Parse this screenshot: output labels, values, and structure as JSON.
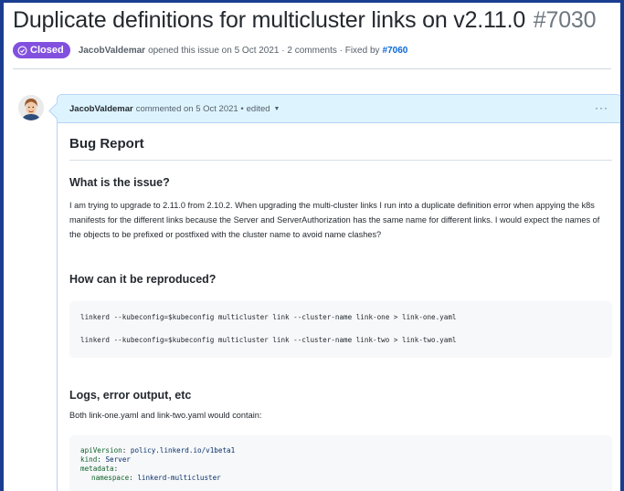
{
  "issue": {
    "title": "Duplicate definitions for multicluster links on v2.11.0",
    "number": "#7030",
    "state": "Closed",
    "author": "JacobValdemar",
    "opened_text": "opened this issue on 5 Oct 2021 · 2 comments · Fixed by",
    "fixed_by": "#7060"
  },
  "comment": {
    "author": "JacobValdemar",
    "meta": "commented on 5 Oct 2021 •",
    "edited": "edited",
    "more": "···",
    "heading": "Bug Report",
    "sections": [
      {
        "heading": "What is the issue?",
        "text": "I am trying to upgrade to 2.11.0 from 2.10.2. When upgrading the multi-cluster links I run into a duplicate definition error when appying the k8s manifests for the different links because the Server and ServerAuthorization has the same name for different links. I would expect the names of the objects to be prefixed or postfixed with the cluster name to avoid name clashes?"
      },
      {
        "heading": "How can it be reproduced?",
        "code": [
          "linkerd --kubeconfig=$kubeconfig multicluster link --cluster-name link-one > link-one.yaml",
          "linkerd --kubeconfig=$kubeconfig multicluster link --cluster-name link-two > link-two.yaml"
        ]
      },
      {
        "heading": "Logs, error output, etc",
        "text": "Both link-one.yaml and link-two.yaml would contain:",
        "yaml": [
          {
            "key": "apiVersion",
            "value": "policy.linkerd.io/v1beta1",
            "indent": 0
          },
          {
            "key": "kind",
            "value": "Server",
            "indent": 0
          },
          {
            "key": "metadata",
            "value": "",
            "indent": 0
          },
          {
            "key": "namespace",
            "value": "linkerd-multicluster",
            "indent": 1
          }
        ]
      }
    ]
  },
  "colors": {
    "closed_badge": "#8250df",
    "link": "#0969da",
    "comment_header": "#ddf4ff",
    "code_bg": "#f6f8fa",
    "outer_frame": "#1a3d8f"
  }
}
